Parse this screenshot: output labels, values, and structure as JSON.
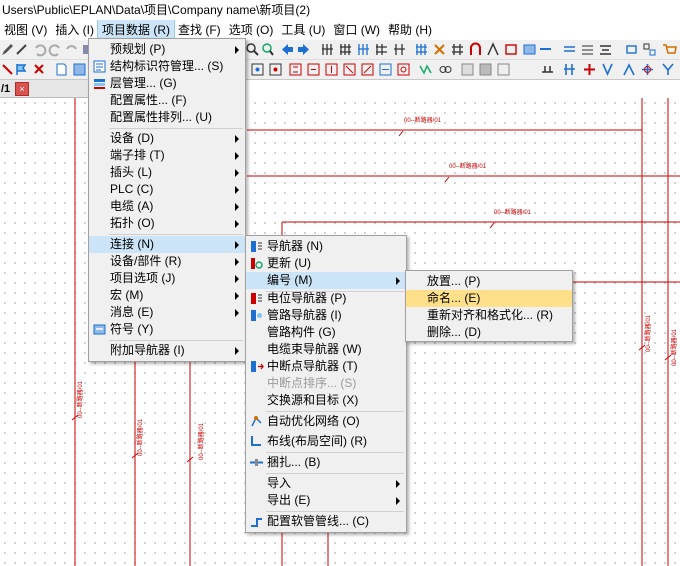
{
  "window": {
    "title": "Users\\Public\\EPLAN\\Data\\项目\\Company name\\新项目(2)"
  },
  "menubar": [
    {
      "label": "视图 (V)"
    },
    {
      "label": "插入 (I)"
    },
    {
      "label": "项目数据 (R)"
    },
    {
      "label": "查找 (F)"
    },
    {
      "label": "选项 (O)"
    },
    {
      "label": "工具 (U)"
    },
    {
      "label": "窗口 (W)"
    },
    {
      "label": "帮助 (H)"
    }
  ],
  "tab": {
    "page_label": "/1",
    "close_glyph": "×"
  },
  "canvas": {
    "segment_label": "00--断路器/01",
    "line_color": "#cc0000"
  },
  "menu_project_data": [
    {
      "label": "预规划 (P)",
      "submenu": true
    },
    {
      "label": "结构标识符管理... (S)",
      "icon": "structure-id-icon"
    },
    {
      "label": "层管理... (G)",
      "icon": "layer-icon"
    },
    {
      "label": "配置属性... (F)"
    },
    {
      "label": "配置属性排列... (U)"
    },
    {
      "label": "设备 (D)",
      "submenu": true
    },
    {
      "label": "端子排 (T)",
      "submenu": true
    },
    {
      "label": "插头 (L)",
      "submenu": true
    },
    {
      "label": "PLC (C)",
      "submenu": true
    },
    {
      "label": "电缆 (A)",
      "submenu": true
    },
    {
      "label": "拓扑 (O)",
      "submenu": true
    },
    {
      "label": "连接 (N)",
      "submenu": true
    },
    {
      "label": "设备/部件 (R)",
      "submenu": true
    },
    {
      "label": "项目选项 (J)",
      "submenu": true
    },
    {
      "label": "宏 (M)",
      "submenu": true
    },
    {
      "label": "消息 (E)",
      "submenu": true
    },
    {
      "label": "符号 (Y)",
      "icon": "symbol-icon"
    },
    {
      "label": "附加导航器 (I)",
      "submenu": true
    }
  ],
  "menu_connections": [
    {
      "label": "导航器 (N)",
      "icon": "navigator-icon"
    },
    {
      "label": "更新 (U)",
      "icon": "update-icon"
    },
    {
      "label": "编号 (M)",
      "submenu": true
    },
    {
      "label": "电位导航器 (P)",
      "icon": "potential-navigator-icon"
    },
    {
      "label": "管路导航器 (I)",
      "icon": "pipe-navigator-icon"
    },
    {
      "label": "管路构件 (G)"
    },
    {
      "label": "电缆束导航器 (W)"
    },
    {
      "label": "中断点导航器 (T)",
      "icon": "interruption-navigator-icon"
    },
    {
      "label": "中断点排序... (S)",
      "disabled": true
    },
    {
      "label": "交换源和目标 (X)"
    },
    {
      "label": "自动优化网络 (O)",
      "icon": "optimize-network-icon"
    },
    {
      "label": "布线(布局空间) (R)",
      "icon": "routing-icon"
    },
    {
      "label": "捆扎... (B)",
      "icon": "bundle-icon"
    },
    {
      "label": "导入",
      "submenu": true
    },
    {
      "label": "导出 (E)",
      "submenu": true
    },
    {
      "label": "配置软管管线... (C)",
      "icon": "hose-icon"
    }
  ],
  "menu_numbering": [
    {
      "label": "放置... (P)"
    },
    {
      "label": "命名... (E)"
    },
    {
      "label": "重新对齐和格式化... (R)"
    },
    {
      "label": "删除... (D)"
    }
  ]
}
